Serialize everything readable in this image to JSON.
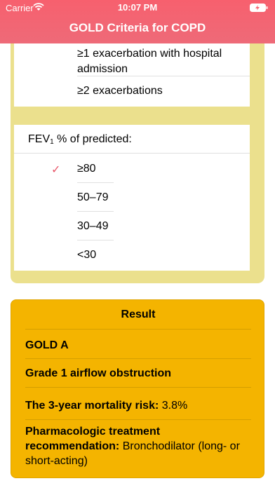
{
  "status": {
    "carrier": "Carrier",
    "time": "10:07 PM"
  },
  "nav": {
    "title": "GOLD Criteria for COPD"
  },
  "exacerbations": {
    "options": [
      "≥1 exacerbation with hospital admission",
      "≥2 exacerbations"
    ]
  },
  "fev": {
    "label_prefix": "FEV",
    "label_sub": "1",
    "label_suffix": " % of predicted:",
    "options": [
      "≥80",
      "50–79",
      "30–49",
      "<30"
    ],
    "selected_index": 0,
    "check_mark": "✓"
  },
  "result": {
    "title": "Result",
    "gold": "GOLD A",
    "grade": "Grade 1 airflow obstruction",
    "mortality_label": "The 3-year mortality risk:",
    "mortality_value": " 3.8%",
    "treatment_label": "Pharmacologic treatment recommendation:",
    "treatment_value": " Bronchodilator (long- or short-acting)"
  },
  "colors": {
    "header": "#f7606e",
    "yellow_card": "#ebe08d",
    "result_bg": "#f4b400",
    "check": "#e8576a"
  }
}
